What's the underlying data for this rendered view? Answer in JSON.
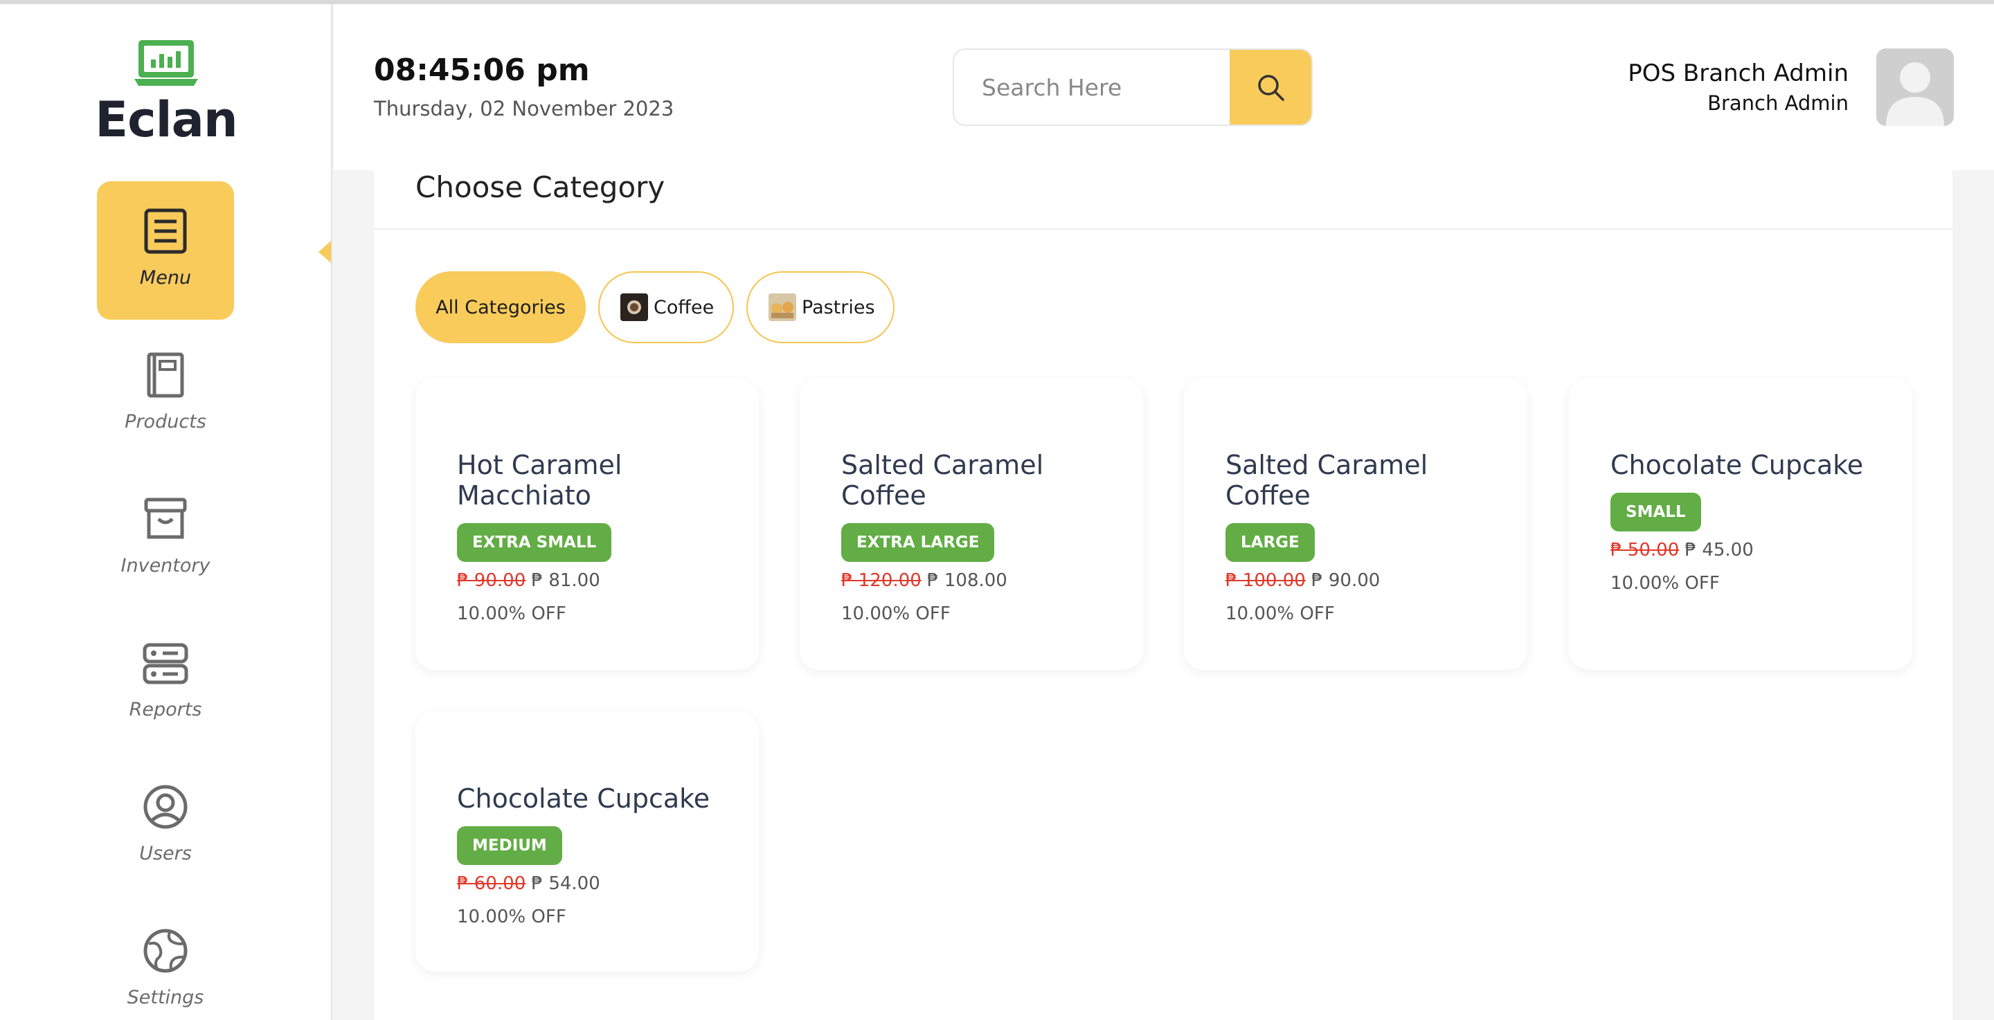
{
  "app": {
    "logo_text": "Eclan",
    "brand_color": "#4caf50",
    "accent_color": "#f8cb5b"
  },
  "sidebar": {
    "items": [
      {
        "label": "Menu",
        "icon": "menu-icon",
        "active": true
      },
      {
        "label": "Products",
        "icon": "book-icon",
        "active": false
      },
      {
        "label": "Inventory",
        "icon": "archive-box-icon",
        "active": false
      },
      {
        "label": "Reports",
        "icon": "server-icon",
        "active": false
      },
      {
        "label": "Users",
        "icon": "user-circle-icon",
        "active": false
      },
      {
        "label": "Settings",
        "icon": "globe-icon",
        "active": false
      }
    ]
  },
  "header": {
    "time": "08:45:06 pm",
    "date": "Thursday, 02 November 2023",
    "search_placeholder": "Search Here",
    "user_name": "POS Branch Admin",
    "user_role": "Branch Admin"
  },
  "main": {
    "title": "Choose Category",
    "categories": [
      {
        "label": "All Categories",
        "active": true
      },
      {
        "label": "Coffee",
        "active": false
      },
      {
        "label": "Pastries",
        "active": false
      }
    ],
    "products": [
      {
        "name": "Hot Caramel Macchiato",
        "size": "EXTRA SMALL",
        "old_price": "₱ 90.00",
        "price": "₱ 81.00",
        "discount": "10.00% OFF"
      },
      {
        "name": "Salted Caramel Coffee",
        "size": "EXTRA LARGE",
        "old_price": "₱ 120.00",
        "price": "₱ 108.00",
        "discount": "10.00% OFF"
      },
      {
        "name": "Salted Caramel Coffee",
        "size": "LARGE",
        "old_price": "₱ 100.00",
        "price": "₱ 90.00",
        "discount": "10.00% OFF"
      },
      {
        "name": "Chocolate Cupcake",
        "size": "SMALL",
        "old_price": "₱ 50.00",
        "price": "₱ 45.00",
        "discount": "10.00% OFF"
      },
      {
        "name": "Chocolate Cupcake",
        "size": "MEDIUM",
        "old_price": "₱ 60.00",
        "price": "₱ 54.00",
        "discount": "10.00% OFF"
      }
    ]
  }
}
